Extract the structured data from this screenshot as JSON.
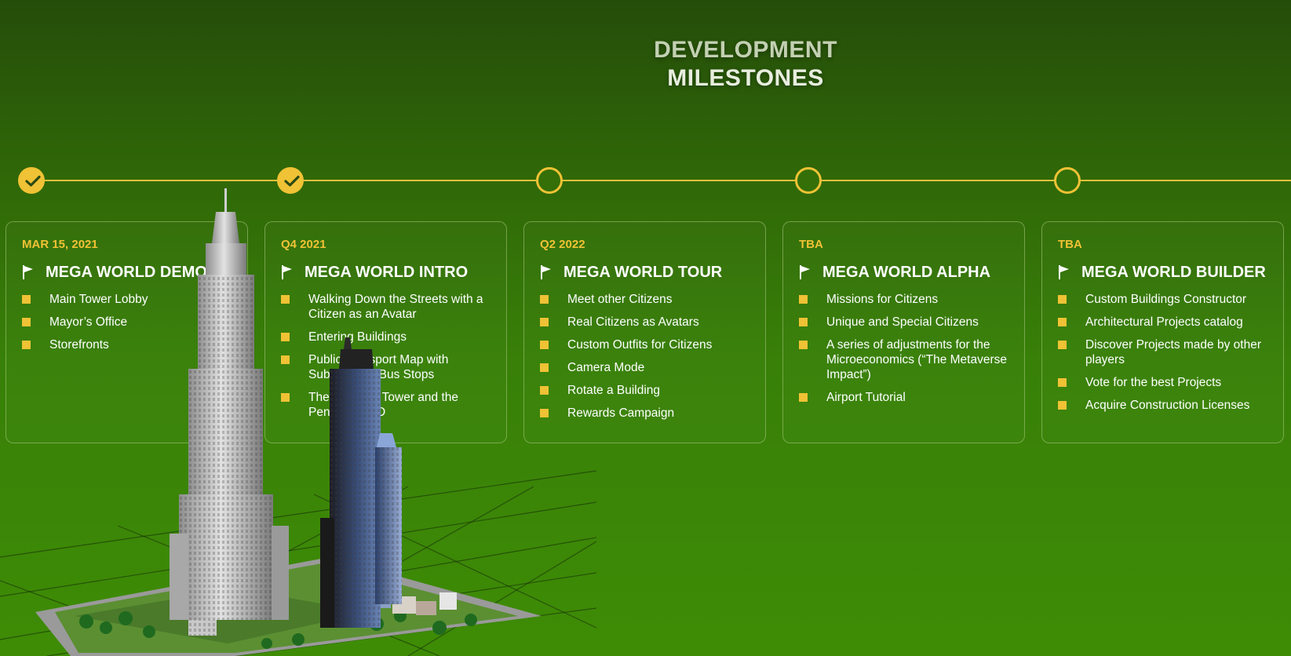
{
  "title": {
    "line1": "DEVELOPMENT",
    "line2": "MILESTONES"
  },
  "colors": {
    "accent": "#f0c235",
    "background_top": "#254d0a",
    "background_bottom": "#3e8c06",
    "text": "#ffffff"
  },
  "milestones": [
    {
      "status": "done",
      "date": "MAR 15, 2021",
      "heading": "MEGA WORLD DEMO",
      "items": [
        "Main Tower Lobby",
        "Mayor’s Office",
        "Storefronts"
      ]
    },
    {
      "status": "done",
      "date": "Q4 2021",
      "heading": "MEGA WORLD INTRO",
      "items": [
        "Walking Down the Streets with a Citizen as an Avatar",
        "Entering Buildings",
        "Public Transport Map with Subway and Bus Stops",
        "The Flagship Tower and the Penthouse 3D"
      ]
    },
    {
      "status": "open",
      "date": "Q2 2022",
      "heading": "MEGA WORLD TOUR",
      "items": [
        "Meet other Citizens",
        "Real Citizens as Avatars",
        "Custom Outfits for Citizens",
        "Camera Mode",
        "Rotate a Building",
        "Rewards Campaign"
      ]
    },
    {
      "status": "open",
      "date": "TBA",
      "heading": "MEGA WORLD ALPHA",
      "items": [
        "Missions for Citizens",
        "Unique and Special Citizens",
        "A series of adjustments for the Microeconomics (“The Metaverse Impact”)",
        "Airport Tutorial"
      ]
    },
    {
      "status": "open",
      "date": "TBA",
      "heading": "MEGA WORLD BUILDER",
      "items": [
        "Custom Buildings Constructor",
        "Architectural Projects catalog",
        "Discover Projects made by other players",
        "Vote for the best Projects",
        "Acquire Construction Licenses"
      ]
    }
  ],
  "icons": {
    "done_node": "check-circle-icon",
    "open_node": "empty-circle-icon",
    "heading": "flag-icon",
    "bullet": "square-bullet-icon"
  }
}
